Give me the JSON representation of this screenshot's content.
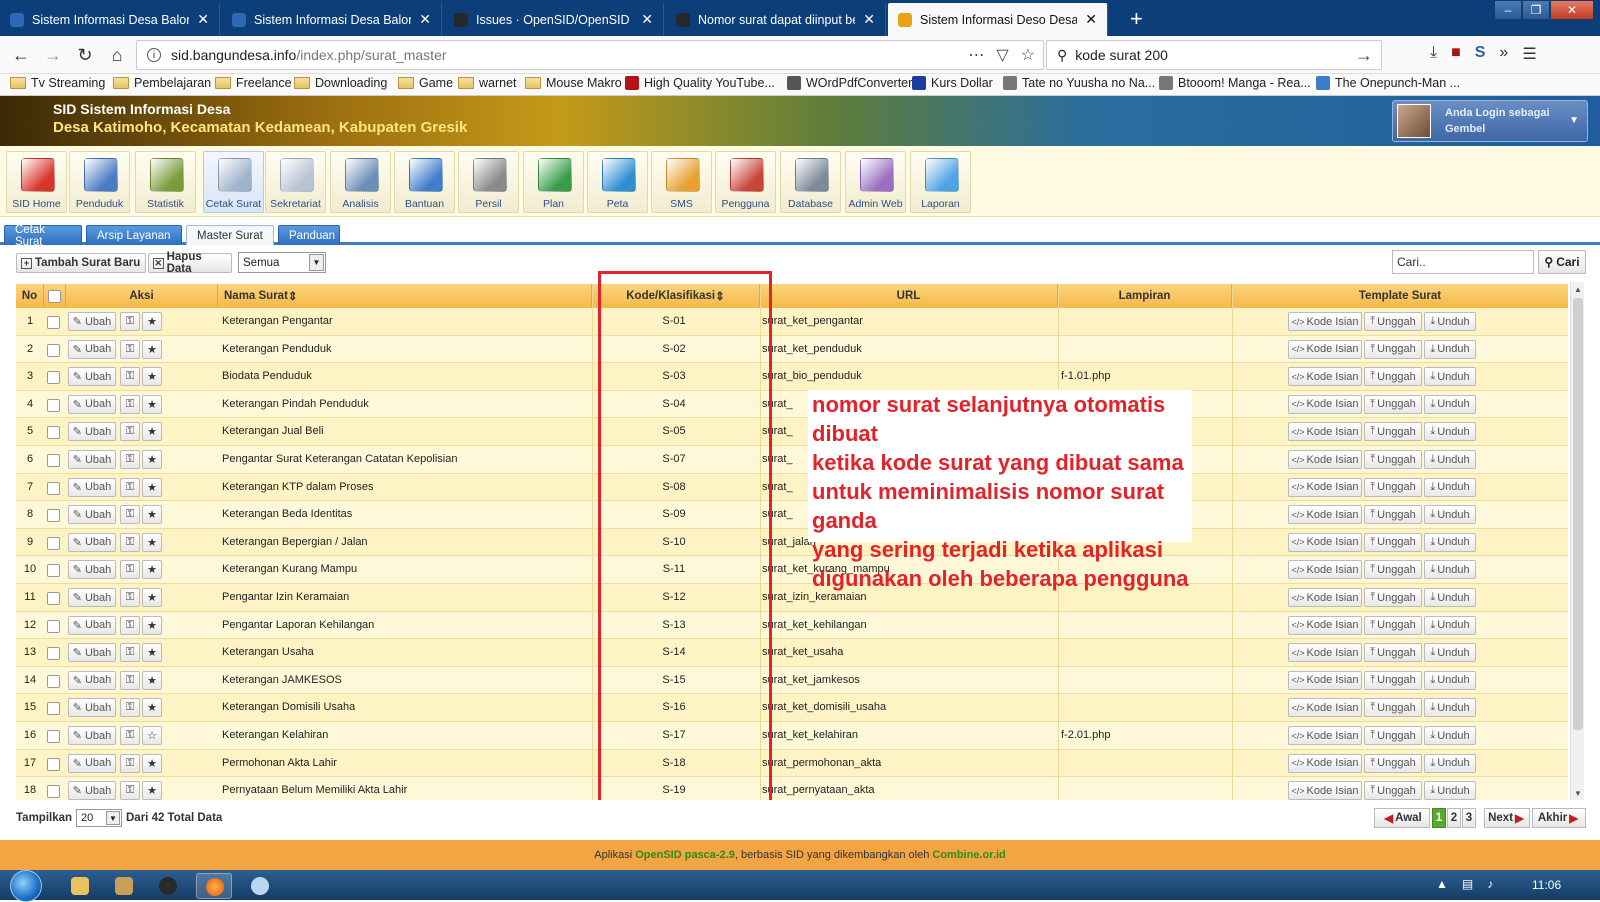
{
  "browser": {
    "tabs": [
      {
        "label": "Sistem Informasi Desa Balongb",
        "fav": "#2c68b8"
      },
      {
        "label": "Sistem Informasi Desa Balongb",
        "fav": "#2c68b8"
      },
      {
        "label": "Issues · OpenSID/OpenSID · Git",
        "fav": "#24292e"
      },
      {
        "label": "Nomor surat dapat diinput ber",
        "fav": "#24292e"
      },
      {
        "label": "Sistem Informasi Deso Desa Ka",
        "fav": "#e8a317"
      }
    ],
    "url_host": "sid.bangundesa.info",
    "url_path": "/index.php/surat_master",
    "search_value": "kode surat 200",
    "bookmarks": [
      {
        "label": "Tv Streaming",
        "type": "folder"
      },
      {
        "label": "Pembelajaran",
        "type": "folder"
      },
      {
        "label": "Freelance",
        "type": "folder"
      },
      {
        "label": "Downloading",
        "type": "folder"
      },
      {
        "label": "Game",
        "type": "folder"
      },
      {
        "label": "warnet",
        "type": "folder"
      },
      {
        "label": "Mouse Makro",
        "type": "folder"
      },
      {
        "label": "High Quality YouTube...",
        "type": "site",
        "color": "#b31217"
      },
      {
        "label": "WOrdPdfConverter",
        "type": "site",
        "color": "#555"
      },
      {
        "label": "Kurs Dollar",
        "type": "site",
        "color": "#1a3e9e"
      },
      {
        "label": "Tate no Yuusha no Na...",
        "type": "site",
        "color": "#777"
      },
      {
        "label": "Btooom! Manga - Rea...",
        "type": "site",
        "color": "#777"
      },
      {
        "label": "The Onepunch-Man ...",
        "type": "site",
        "color": "#3b7dc6"
      }
    ]
  },
  "app": {
    "title": "SID Sistem Informasi Desa",
    "subtitle": "Desa Katimoho, Kecamatan Kedamean, Kabupaten Gresik",
    "login_label": "Anda Login sebagai",
    "login_user": "Gembel",
    "modules": [
      {
        "label": "SID Home",
        "color": "#d9362b"
      },
      {
        "label": "Penduduk",
        "color": "#4a7cc2"
      },
      {
        "label": "Statistik",
        "color": "#7a9c3a"
      },
      {
        "label": "Cetak Surat",
        "color": "#9fb3cc"
      },
      {
        "label": "Sekretariat",
        "color": "#b8c4d6"
      },
      {
        "label": "Analisis",
        "color": "#6d8fb5"
      },
      {
        "label": "Bantuan",
        "color": "#3f7fc9"
      },
      {
        "label": "Persil",
        "color": "#8a8a8a"
      },
      {
        "label": "Plan",
        "color": "#3a9d4a"
      },
      {
        "label": "Peta",
        "color": "#2f8fd0"
      },
      {
        "label": "SMS",
        "color": "#e8a030"
      },
      {
        "label": "Pengguna",
        "color": "#c9453a"
      },
      {
        "label": "Database",
        "color": "#7c8a9a"
      },
      {
        "label": "Admin Web",
        "color": "#9a6fc0"
      },
      {
        "label": "Laporan",
        "color": "#4fa3e0"
      }
    ],
    "subtabs": [
      "Cetak Surat",
      "Arsip Layanan",
      "Master Surat",
      "Panduan"
    ],
    "active_subtab": "Master Surat",
    "add_button": "Tambah Surat Baru",
    "delete_button": "Hapus Data",
    "filter_value": "Semua",
    "search_placeholder": "Cari..",
    "search_button": "Cari"
  },
  "table": {
    "headers": {
      "no": "No",
      "aksi": "Aksi",
      "nama": "Nama Surat",
      "kode": "Kode/Klasifikasi",
      "url": "URL",
      "lampiran": "Lampiran",
      "template": "Template Surat"
    },
    "buttons": {
      "ubah": "Ubah",
      "kode_isian": "Kode Isian",
      "unggah": "Unggah",
      "unduh": "Unduh"
    },
    "rows": [
      {
        "no": "1",
        "nama": "Keterangan Pengantar",
        "kode": "S-01",
        "url": "surat_ket_pengantar",
        "lampiran": "",
        "fav": true
      },
      {
        "no": "2",
        "nama": "Keterangan Penduduk",
        "kode": "S-02",
        "url": "surat_ket_penduduk",
        "lampiran": "",
        "fav": true
      },
      {
        "no": "3",
        "nama": "Biodata Penduduk",
        "kode": "S-03",
        "url": "surat_bio_penduduk",
        "lampiran": "f-1.01.php",
        "fav": true
      },
      {
        "no": "4",
        "nama": "Keterangan Pindah Penduduk",
        "kode": "S-04",
        "url": "surat_",
        "lampiran": "",
        "fav": true
      },
      {
        "no": "5",
        "nama": "Keterangan Jual Beli",
        "kode": "S-05",
        "url": "surat_",
        "lampiran": "",
        "fav": true
      },
      {
        "no": "6",
        "nama": "Pengantar Surat Keterangan Catatan Kepolisian",
        "kode": "S-07",
        "url": "surat_",
        "lampiran": "",
        "fav": true
      },
      {
        "no": "7",
        "nama": "Keterangan KTP dalam Proses",
        "kode": "S-08",
        "url": "surat_",
        "lampiran": "",
        "fav": true
      },
      {
        "no": "8",
        "nama": "Keterangan Beda Identitas",
        "kode": "S-09",
        "url": "surat_",
        "lampiran": "",
        "fav": true
      },
      {
        "no": "9",
        "nama": "Keterangan Bepergian / Jalan",
        "kode": "S-10",
        "url": "surat_jalan",
        "lampiran": "",
        "fav": true
      },
      {
        "no": "10",
        "nama": "Keterangan Kurang Mampu",
        "kode": "S-11",
        "url": "surat_ket_kurang_mampu",
        "lampiran": "",
        "fav": true
      },
      {
        "no": "11",
        "nama": "Pengantar Izin Keramaian",
        "kode": "S-12",
        "url": "surat_izin_keramaian",
        "lampiran": "",
        "fav": true
      },
      {
        "no": "12",
        "nama": "Pengantar Laporan Kehilangan",
        "kode": "S-13",
        "url": "surat_ket_kehilangan",
        "lampiran": "",
        "fav": true
      },
      {
        "no": "13",
        "nama": "Keterangan Usaha",
        "kode": "S-14",
        "url": "surat_ket_usaha",
        "lampiran": "",
        "fav": true
      },
      {
        "no": "14",
        "nama": "Keterangan JAMKESOS",
        "kode": "S-15",
        "url": "surat_ket_jamkesos",
        "lampiran": "",
        "fav": true
      },
      {
        "no": "15",
        "nama": "Keterangan Domisili Usaha",
        "kode": "S-16",
        "url": "surat_ket_domisili_usaha",
        "lampiran": "",
        "fav": true
      },
      {
        "no": "16",
        "nama": "Keterangan Kelahiran",
        "kode": "S-17",
        "url": "surat_ket_kelahiran",
        "lampiran": "f-2.01.php",
        "fav": false
      },
      {
        "no": "17",
        "nama": "Permohonan Akta Lahir",
        "kode": "S-18",
        "url": "surat_permohonan_akta",
        "lampiran": "",
        "fav": true
      },
      {
        "no": "18",
        "nama": "Pernyataan Belum Memiliki Akta Lahir",
        "kode": "S-19",
        "url": "surat_pernyataan_akta",
        "lampiran": "",
        "fav": true
      }
    ]
  },
  "annotation": {
    "lines": [
      "nomor surat selanjutnya otomatis dibuat",
      "ketika kode surat yang dibuat sama",
      "untuk meminimalisis nomor surat ganda",
      "yang sering terjadi ketika aplikasi",
      "digunakan oleh beberapa pengguna"
    ]
  },
  "pagination": {
    "show_label": "Tampilkan",
    "per_page": "20",
    "total_label": "Dari 42 Total Data",
    "first": "Awal",
    "pages": [
      "1",
      "2",
      "3"
    ],
    "current": "1",
    "next": "Next",
    "last": "Akhir"
  },
  "footer": {
    "pre": "Aplikasi",
    "app": "OpenSID pasca-2.9",
    "mid": ", berbasis SID yang dikembangkan oleh",
    "org": "Combine.or.id"
  },
  "taskbar": {
    "clock": "11:06"
  }
}
